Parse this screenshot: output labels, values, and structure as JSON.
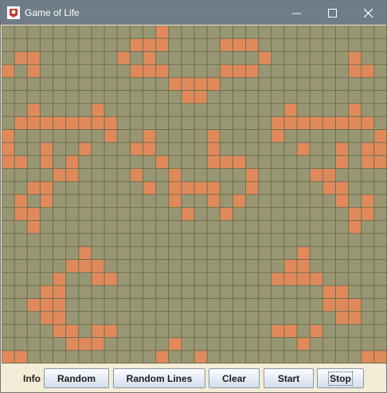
{
  "window": {
    "title": "Game of Life"
  },
  "grid": {
    "cols": 30,
    "rows": 26,
    "dead_color": "#989673",
    "live_color": "#e08a5c",
    "line_color": "#6f6f4e",
    "live_cells": [
      [
        0,
        12
      ],
      [
        1,
        10
      ],
      [
        1,
        11
      ],
      [
        1,
        12
      ],
      [
        1,
        17
      ],
      [
        1,
        18
      ],
      [
        1,
        19
      ],
      [
        2,
        1
      ],
      [
        2,
        2
      ],
      [
        2,
        9
      ],
      [
        2,
        11
      ],
      [
        2,
        20
      ],
      [
        2,
        27
      ],
      [
        3,
        0
      ],
      [
        3,
        2
      ],
      [
        3,
        10
      ],
      [
        3,
        11
      ],
      [
        3,
        12
      ],
      [
        3,
        17
      ],
      [
        3,
        18
      ],
      [
        3,
        19
      ],
      [
        3,
        27
      ],
      [
        3,
        28
      ],
      [
        4,
        13
      ],
      [
        4,
        14
      ],
      [
        4,
        15
      ],
      [
        4,
        16
      ],
      [
        5,
        14
      ],
      [
        5,
        15
      ],
      [
        6,
        2
      ],
      [
        6,
        7
      ],
      [
        6,
        22
      ],
      [
        6,
        27
      ],
      [
        7,
        1
      ],
      [
        7,
        2
      ],
      [
        7,
        3
      ],
      [
        7,
        4
      ],
      [
        7,
        5
      ],
      [
        7,
        6
      ],
      [
        7,
        7
      ],
      [
        7,
        8
      ],
      [
        7,
        21
      ],
      [
        7,
        22
      ],
      [
        7,
        23
      ],
      [
        7,
        24
      ],
      [
        7,
        25
      ],
      [
        7,
        26
      ],
      [
        7,
        27
      ],
      [
        7,
        28
      ],
      [
        8,
        0
      ],
      [
        8,
        8
      ],
      [
        8,
        11
      ],
      [
        8,
        16
      ],
      [
        8,
        21
      ],
      [
        8,
        29
      ],
      [
        9,
        0
      ],
      [
        9,
        3
      ],
      [
        9,
        6
      ],
      [
        9,
        10
      ],
      [
        9,
        11
      ],
      [
        9,
        16
      ],
      [
        9,
        23
      ],
      [
        9,
        26
      ],
      [
        9,
        28
      ],
      [
        9,
        29
      ],
      [
        10,
        0
      ],
      [
        10,
        1
      ],
      [
        10,
        3
      ],
      [
        10,
        5
      ],
      [
        10,
        12
      ],
      [
        10,
        16
      ],
      [
        10,
        17
      ],
      [
        10,
        18
      ],
      [
        10,
        26
      ],
      [
        10,
        28
      ],
      [
        10,
        29
      ],
      [
        11,
        4
      ],
      [
        11,
        5
      ],
      [
        11,
        10
      ],
      [
        11,
        13
      ],
      [
        11,
        19
      ],
      [
        11,
        24
      ],
      [
        11,
        25
      ],
      [
        12,
        2
      ],
      [
        12,
        3
      ],
      [
        12,
        11
      ],
      [
        12,
        13
      ],
      [
        12,
        14
      ],
      [
        12,
        15
      ],
      [
        12,
        16
      ],
      [
        12,
        19
      ],
      [
        12,
        25
      ],
      [
        12,
        26
      ],
      [
        13,
        1
      ],
      [
        13,
        3
      ],
      [
        13,
        13
      ],
      [
        13,
        16
      ],
      [
        13,
        18
      ],
      [
        13,
        26
      ],
      [
        13,
        28
      ],
      [
        14,
        1
      ],
      [
        14,
        2
      ],
      [
        14,
        14
      ],
      [
        14,
        17
      ],
      [
        14,
        27
      ],
      [
        14,
        28
      ],
      [
        15,
        2
      ],
      [
        15,
        27
      ],
      [
        17,
        6
      ],
      [
        17,
        23
      ],
      [
        18,
        5
      ],
      [
        18,
        6
      ],
      [
        18,
        7
      ],
      [
        18,
        22
      ],
      [
        18,
        23
      ],
      [
        19,
        4
      ],
      [
        19,
        7
      ],
      [
        19,
        8
      ],
      [
        19,
        21
      ],
      [
        19,
        22
      ],
      [
        19,
        23
      ],
      [
        19,
        24
      ],
      [
        20,
        3
      ],
      [
        20,
        4
      ],
      [
        20,
        25
      ],
      [
        20,
        26
      ],
      [
        21,
        2
      ],
      [
        21,
        3
      ],
      [
        21,
        4
      ],
      [
        21,
        25
      ],
      [
        21,
        26
      ],
      [
        21,
        27
      ],
      [
        22,
        3
      ],
      [
        22,
        4
      ],
      [
        22,
        26
      ],
      [
        22,
        27
      ],
      [
        23,
        4
      ],
      [
        23,
        5
      ],
      [
        23,
        7
      ],
      [
        23,
        8
      ],
      [
        23,
        21
      ],
      [
        23,
        22
      ],
      [
        23,
        24
      ],
      [
        24,
        5
      ],
      [
        24,
        6
      ],
      [
        24,
        7
      ],
      [
        24,
        13
      ],
      [
        24,
        23
      ],
      [
        25,
        0
      ],
      [
        25,
        1
      ],
      [
        25,
        12
      ],
      [
        25,
        15
      ],
      [
        25,
        28
      ],
      [
        25,
        29
      ]
    ]
  },
  "controls": {
    "info_label": "Info",
    "random_label": "Random",
    "random_lines_label": "Random Lines",
    "clear_label": "Clear",
    "start_label": "Start",
    "stop_label": "Stop"
  }
}
